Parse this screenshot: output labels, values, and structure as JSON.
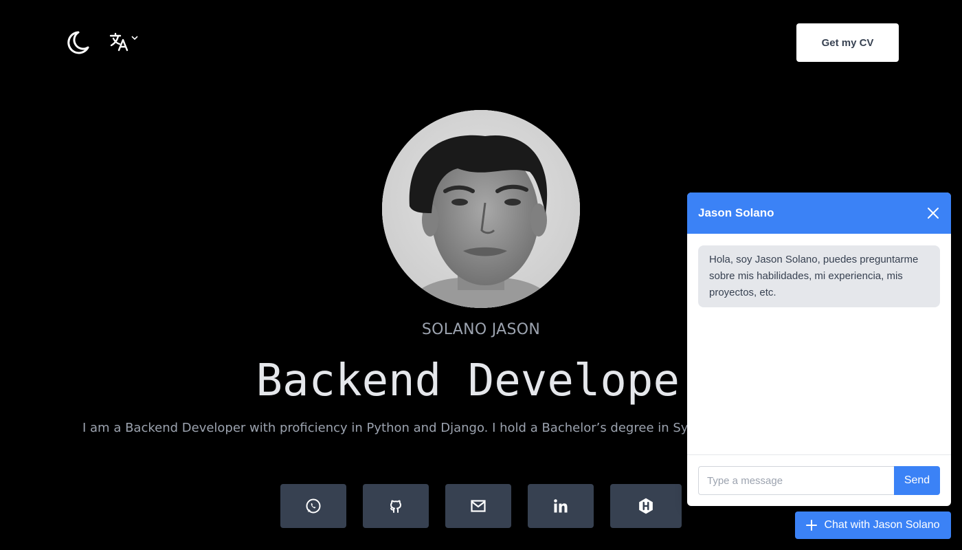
{
  "header": {
    "theme_icon": "moon-icon",
    "language_icon": "translate-icon",
    "cv_button": "Get my CV"
  },
  "hero": {
    "name": "SOLANO JASON",
    "role": "Backend Developer",
    "bio": "I am a Backend Developer with proficiency in Python and Django. I hold a Bachelor’s degree in Syste"
  },
  "socials": [
    {
      "icon": "whatsapp-icon"
    },
    {
      "icon": "github-icon"
    },
    {
      "icon": "mail-icon"
    },
    {
      "icon": "linkedin-icon"
    },
    {
      "icon": "hashnode-icon"
    }
  ],
  "chat": {
    "title": "Jason Solano",
    "messages": [
      {
        "from": "bot",
        "text": "Hola, soy Jason Solano, puedes preguntarme sobre mis habilidades, mi experiencia, mis proyectos, etc."
      }
    ],
    "input_placeholder": "Type a message",
    "send_label": "Send",
    "launcher_label": "Chat with Jason Solano"
  },
  "colors": {
    "background": "#000000",
    "accent": "#3b82f6",
    "social_bg": "#374151"
  }
}
